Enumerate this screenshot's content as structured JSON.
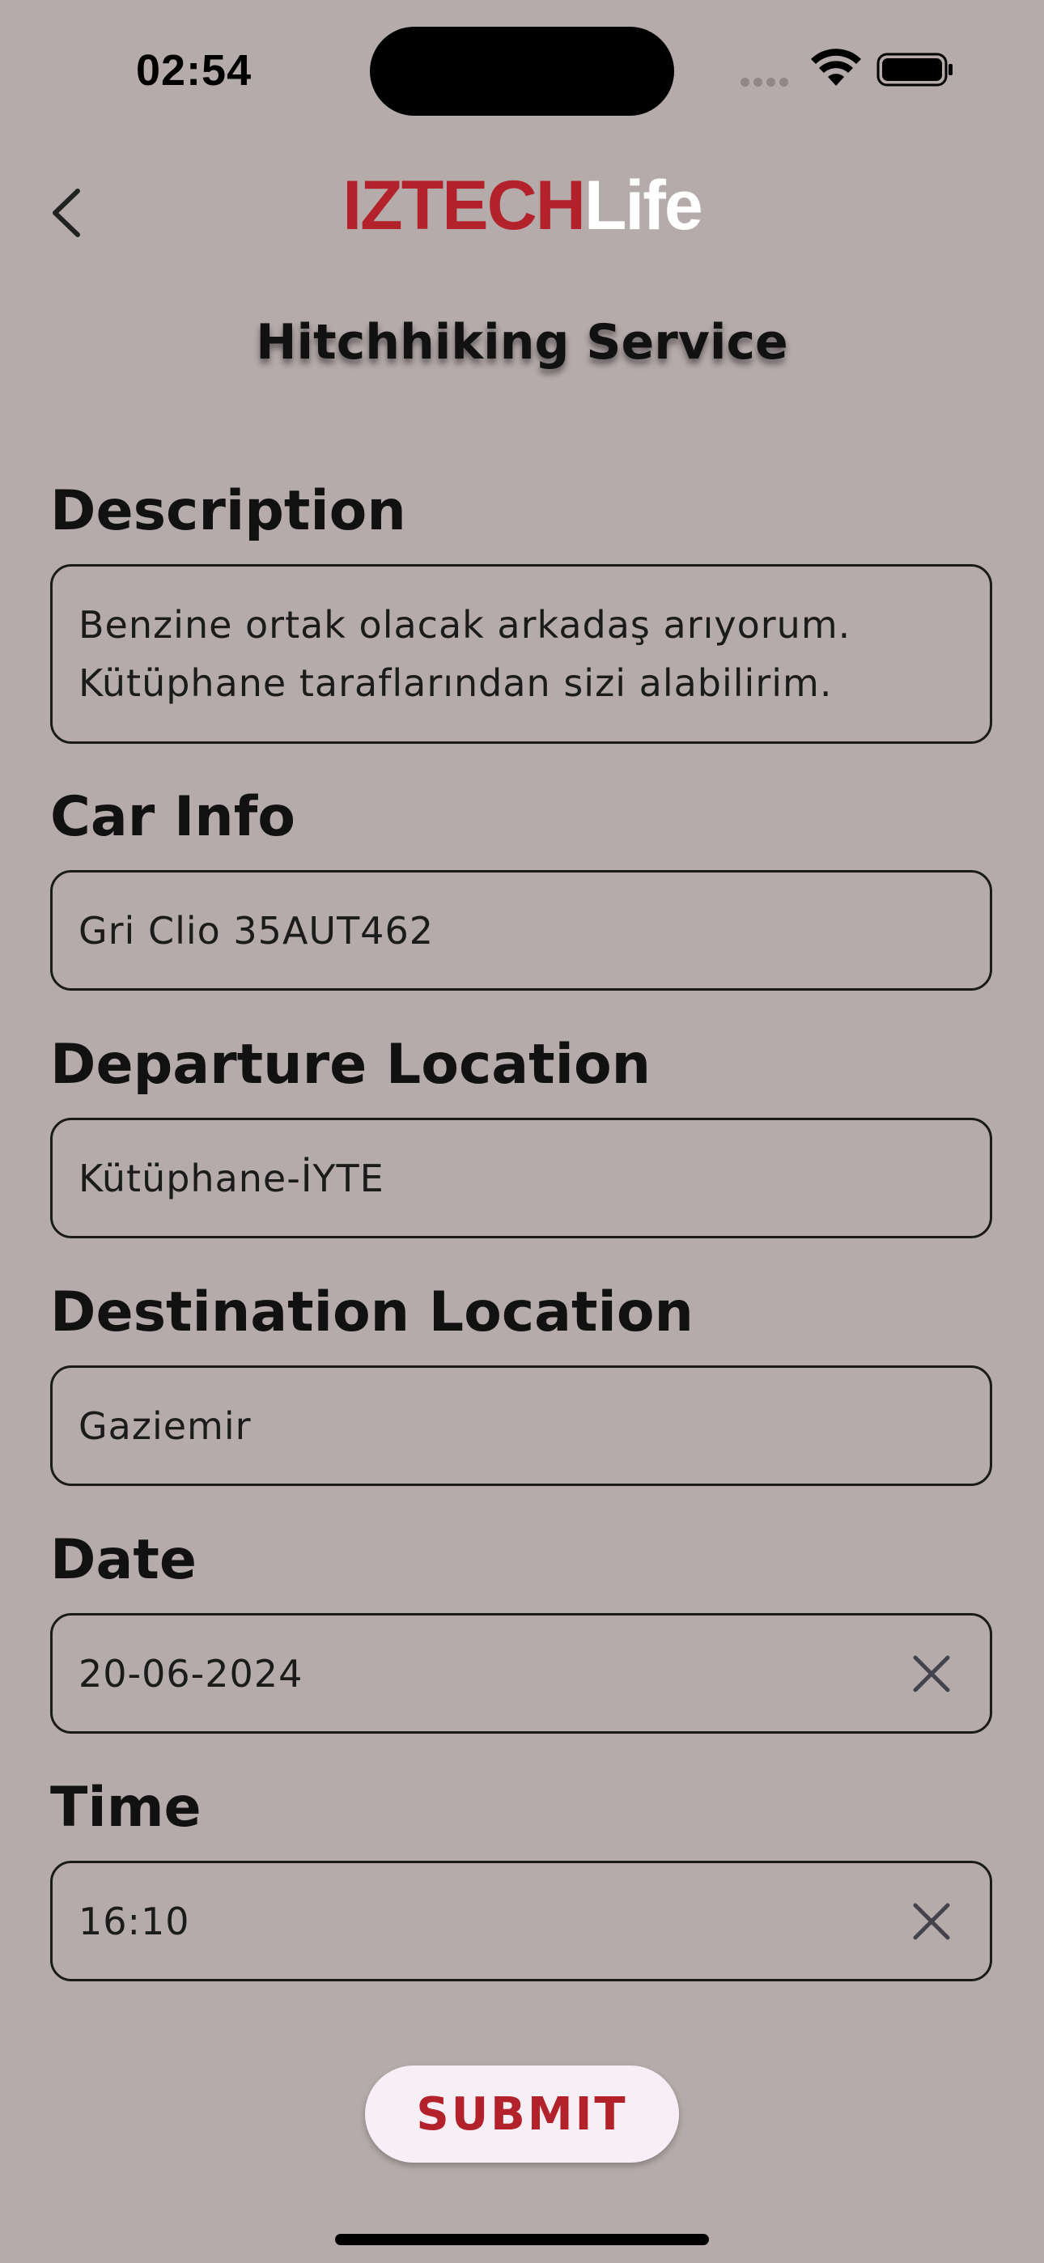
{
  "status_bar": {
    "time": "02:54"
  },
  "header": {
    "logo_part1": "IZTECH",
    "logo_part2": "Life",
    "title": "Hitchhiking Service",
    "back_icon": "chevron-left-icon"
  },
  "form": {
    "description": {
      "label": "Description",
      "value": "Benzine ortak olacak arkadaş arıyorum.\nKütüphane taraflarından sizi alabilirim."
    },
    "car_info": {
      "label": "Car Info",
      "value": "Gri Clio 35AUT462"
    },
    "departure": {
      "label": "Departure Location",
      "value": "Kütüphane-İYTE"
    },
    "destination": {
      "label": "Destination Location",
      "value": "Gaziemir"
    },
    "date": {
      "label": "Date",
      "value": "20-06-2024"
    },
    "time": {
      "label": "Time",
      "value": "16:10"
    }
  },
  "submit_label": "SUBMIT",
  "colors": {
    "background": "#b5abab",
    "accent": "#b3222a",
    "button_bg": "#f6f0f6"
  }
}
